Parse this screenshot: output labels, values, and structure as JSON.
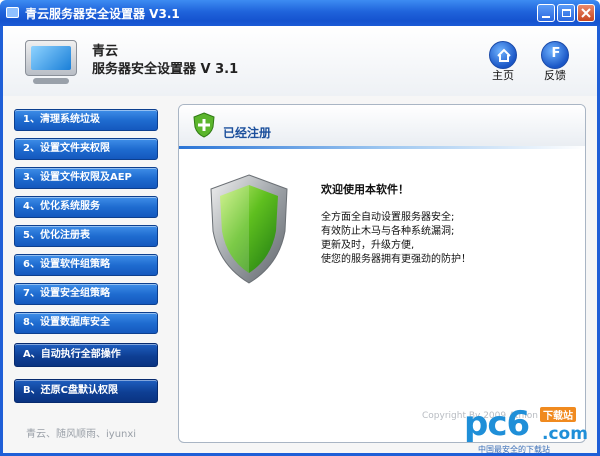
{
  "window": {
    "title": "青云服务器安全设置器  V3.1"
  },
  "header": {
    "app_name_line1": "青云",
    "app_name_line2": "服务器安全设置器  V 3.1",
    "nav": [
      {
        "label": "主页",
        "icon": "home-icon"
      },
      {
        "label": "反馈",
        "icon": "feedback-icon",
        "glyph": "F"
      }
    ]
  },
  "sidebar": {
    "items": [
      {
        "label": "1、清理系统垃圾"
      },
      {
        "label": "2、设置文件夹权限"
      },
      {
        "label": "3、设置文件权限及AEP"
      },
      {
        "label": "4、优化系统服务"
      },
      {
        "label": "5、优化注册表"
      },
      {
        "label": "6、设置软件组策略"
      },
      {
        "label": "7、设置安全组策略"
      },
      {
        "label": "8、设置数据库安全"
      }
    ],
    "actions": [
      {
        "label": "A、自动执行全部操作"
      },
      {
        "label": "B、还原C盘默认权限"
      }
    ],
    "footer": "青云、随风顺雨、iyunxi"
  },
  "panel": {
    "status_title": "已经注册",
    "welcome": "欢迎使用本软件！",
    "lines": [
      "全方面全自动设置服务器安全;",
      "有效防止木马与各种系统漏洞;",
      "更新及时，升级方便,",
      "使您的服务器拥有更强劲的防护！"
    ],
    "copyright": "Copyright By 2009 Athlon"
  },
  "watermark": {
    "brand": "pc6",
    "tag": "下载站",
    "domain": ".com",
    "sub": "中国最安全的下载站"
  },
  "colors": {
    "titlebar": "#1f63db",
    "button": "#1f6cd0",
    "panel_title": "#1b4f9c"
  }
}
